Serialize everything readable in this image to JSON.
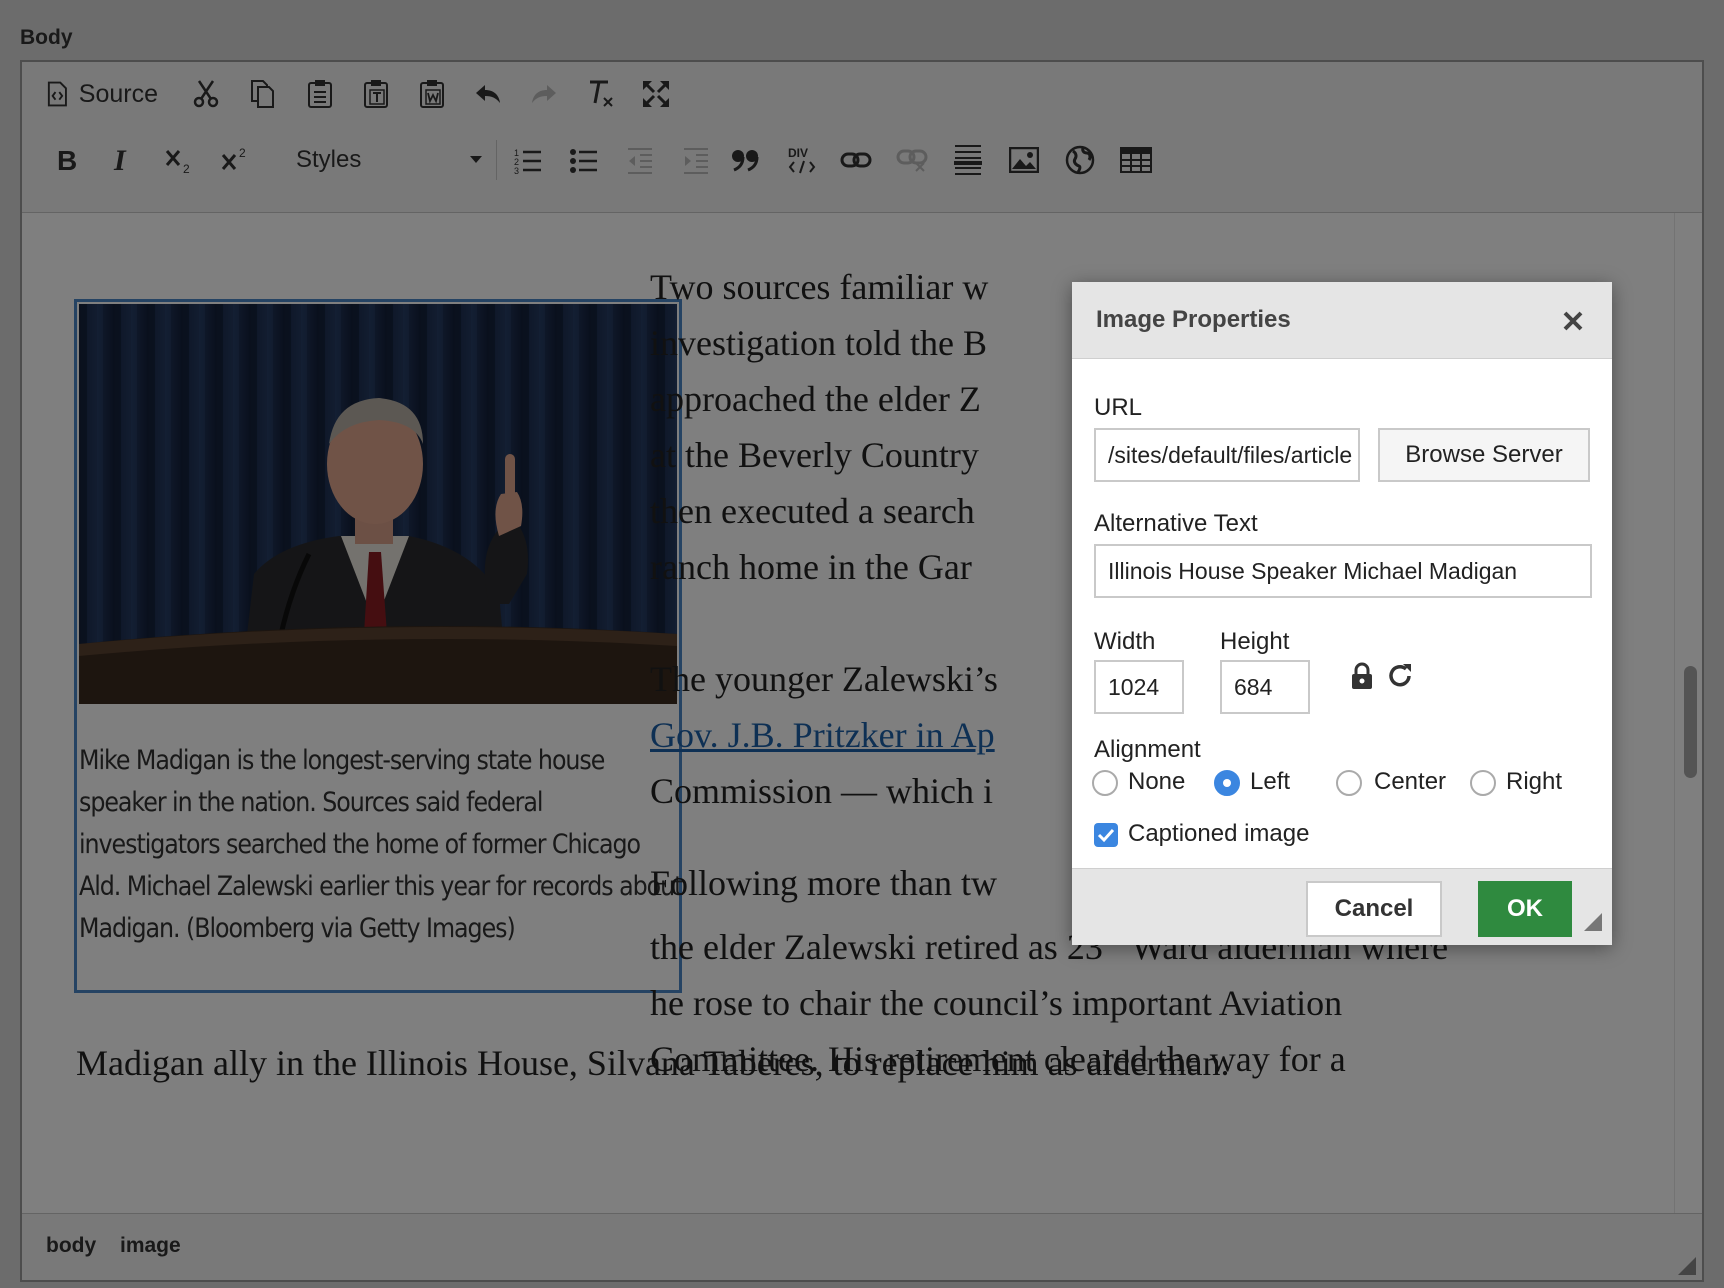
{
  "field_label": "Body",
  "toolbar": {
    "source_label": "Source",
    "styles_label": "Styles"
  },
  "article": {
    "para1": [
      "Two sources familiar w",
      "investigation told the B",
      "approached the elder Z",
      "at the Beverly Country",
      "then executed a search",
      "ranch home in the Gar"
    ],
    "para2_line1": "The younger Zalewski’s",
    "para2_link": "Gov. J.B. Pritzker in Ap",
    "para2_line3": "Commission — which i",
    "para3_line1": "Following more than tw",
    "para3_line2_a": "the elder Zalewski retired as 23",
    "para3_line2_sup": "rd",
    "para3_line2_b": " Ward alderman where",
    "para3_line3": "he rose to chair the council’s important Aviation",
    "para3_line4": "Committee. His retirement cleared the way for a",
    "para3_line5": "Madigan ally in the Illinois House, Silvana Taberes, to replace him as alderman.",
    "caption": "Mike Madigan is the longest-serving state house speaker in the nation. Sources said federal investigators searched the home of former Chicago Ald. Michael Zalewski earlier this year for records about Madigan. (Bloomberg via Getty Images)"
  },
  "statusbar": {
    "path": [
      "body",
      "image"
    ]
  },
  "dialog": {
    "title": "Image Properties",
    "url_label": "URL",
    "url_value": "/sites/default/files/article",
    "browse_label": "Browse Server",
    "alt_label": "Alternative Text",
    "alt_value": "Illinois House Speaker Michael Madigan",
    "width_label": "Width",
    "width_value": "1024",
    "height_label": "Height",
    "height_value": "684",
    "alignment_label": "Alignment",
    "alignment_options": [
      "None",
      "Left",
      "Center",
      "Right"
    ],
    "alignment_selected": "Left",
    "captioned_label": "Captioned image",
    "captioned_checked": true,
    "cancel_label": "Cancel",
    "ok_label": "OK"
  },
  "colors": {
    "ok_button": "#2f8a3f",
    "link": "#1c60a8",
    "selection_border": "#4a86c6",
    "radio_selected": "#3b86e0"
  }
}
